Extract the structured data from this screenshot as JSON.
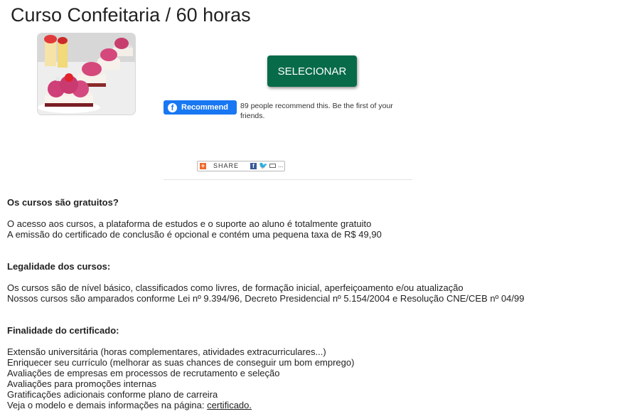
{
  "page": {
    "title": "Curso Confeitaria / 60 horas"
  },
  "actions": {
    "select_label": "SELECIONAR"
  },
  "facebook": {
    "logo_glyph": "f",
    "button_label": "Recommend",
    "recommend_text": "89 people recommend this. Be the first of your friends.",
    "color": "#1877f2"
  },
  "share": {
    "label": "SHARE",
    "more_glyph": "..."
  },
  "faq": [
    {
      "heading": "Os cursos são gratuitos?",
      "lines": [
        "O acesso aos cursos, a plataforma de estudos e o suporte ao aluno é totalmente gratuito",
        "A emissão do certificado de conclusão é opcional e contém uma pequena taxa de R$ 49,90"
      ]
    },
    {
      "heading": "Legalidade dos cursos:",
      "lines": [
        "Os cursos são de nível básico, classificados como livres, de formação inicial, aperfeiçoamento e/ou atualização",
        "Nossos cursos são amparados conforme Lei nº 9.394/96, Decreto Presidencial nº 5.154/2004 e Resolução CNE/CEB nº 04/99"
      ]
    },
    {
      "heading": "Finalidade do certificado:",
      "lines": [
        "Extensão universitária (horas complementares, atividades extracurriculares...)",
        "Enriquecer seu currículo (melhorar as suas chances de conseguir um bom emprego)",
        "Avaliações de empresas em processos de recrutamento e seleção",
        "Avaliações para promoções internas",
        "Gratificações adicionais conforme plano de carreira"
      ],
      "last_line_prefix": "Veja o modelo e demais informações na página:",
      "last_line_link": "certificado."
    }
  ],
  "colors": {
    "select_button": "#076b4a",
    "facebook_blue": "#1877f2"
  }
}
